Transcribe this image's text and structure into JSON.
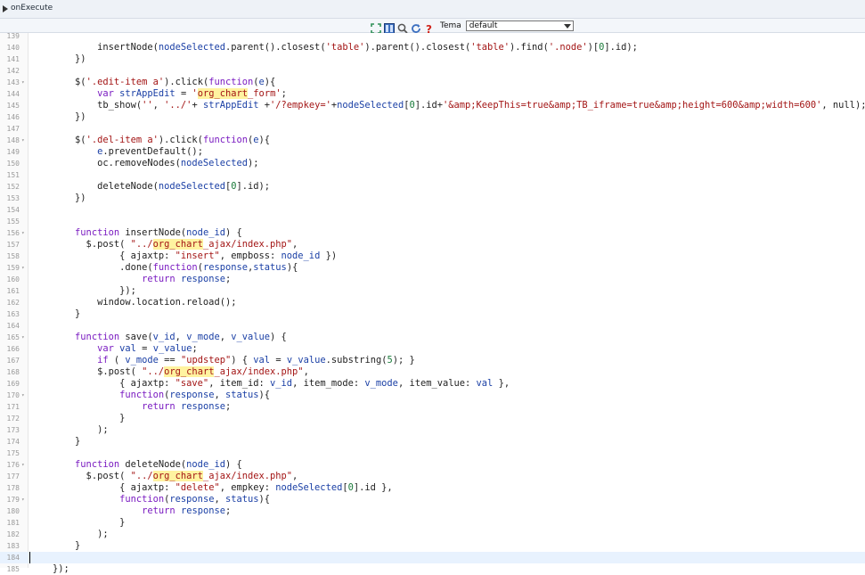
{
  "header": {
    "title": "onExecute"
  },
  "toolbar": {
    "theme_label": "Tema",
    "theme_value": "default",
    "tools": [
      "fullscreen-icon",
      "panel-icon",
      "search-icon",
      "refresh-icon",
      "help-icon"
    ]
  },
  "colors": {
    "keyword": "#7a1bc1",
    "string": "#a31515",
    "variable": "#1a3fa5",
    "number": "#1a7a3a",
    "highlight": "#fff3a0",
    "active_line": "#e8f2fe"
  },
  "editor": {
    "active_line": "184",
    "lines": [
      {
        "n": "139",
        "t": ""
      },
      {
        "n": "140",
        "t": "            insertNode(nodeSelected.parent().closest('table').parent().closest('table').find('.node')[0].id);"
      },
      {
        "n": "141",
        "t": "        })"
      },
      {
        "n": "142",
        "t": ""
      },
      {
        "n": "143",
        "fold": true,
        "t": "        $('.edit-item a').click(function(e){"
      },
      {
        "n": "144",
        "t": "            var strAppEdit = 'org_chart_form';"
      },
      {
        "n": "145",
        "t": "            tb_show('', '../'+ strAppEdit +'/?empkey='+nodeSelected[0].id+'&amp;KeepThis=true&amp;TB_iframe=true&amp;height=600&amp;width=600', null);"
      },
      {
        "n": "146",
        "t": "        })"
      },
      {
        "n": "147",
        "t": ""
      },
      {
        "n": "148",
        "fold": true,
        "t": "        $('.del-item a').click(function(e){"
      },
      {
        "n": "149",
        "t": "            e.preventDefault();"
      },
      {
        "n": "150",
        "t": "            oc.removeNodes(nodeSelected);"
      },
      {
        "n": "151",
        "t": ""
      },
      {
        "n": "152",
        "t": "            deleteNode(nodeSelected[0].id);"
      },
      {
        "n": "153",
        "t": "        })"
      },
      {
        "n": "154",
        "t": ""
      },
      {
        "n": "155",
        "t": ""
      },
      {
        "n": "156",
        "fold": true,
        "t": "        function insertNode(node_id) {"
      },
      {
        "n": "157",
        "t": "          $.post( \"../org_chart_ajax/index.php\","
      },
      {
        "n": "158",
        "t": "                { ajaxtp: \"insert\", empboss: node_id })"
      },
      {
        "n": "159",
        "fold": true,
        "t": "                .done(function(response,status){"
      },
      {
        "n": "160",
        "t": "                    return response;"
      },
      {
        "n": "161",
        "t": "                });"
      },
      {
        "n": "162",
        "t": "            window.location.reload();"
      },
      {
        "n": "163",
        "t": "        }"
      },
      {
        "n": "164",
        "t": ""
      },
      {
        "n": "165",
        "fold": true,
        "t": "        function save(v_id, v_mode, v_value) {"
      },
      {
        "n": "166",
        "t": "            var val = v_value;"
      },
      {
        "n": "167",
        "t": "            if ( v_mode == \"updstep\") { val = v_value.substring(5); }"
      },
      {
        "n": "168",
        "t": "            $.post( \"../org_chart_ajax/index.php\","
      },
      {
        "n": "169",
        "t": "                { ajaxtp: \"save\", item_id: v_id, item_mode: v_mode, item_value: val },"
      },
      {
        "n": "170",
        "fold": true,
        "t": "                function(response, status){"
      },
      {
        "n": "171",
        "t": "                    return response;"
      },
      {
        "n": "172",
        "t": "                }"
      },
      {
        "n": "173",
        "t": "            );"
      },
      {
        "n": "174",
        "t": "        }"
      },
      {
        "n": "175",
        "t": ""
      },
      {
        "n": "176",
        "fold": true,
        "t": "        function deleteNode(node_id) {"
      },
      {
        "n": "177",
        "t": "          $.post( \"../org_chart_ajax/index.php\","
      },
      {
        "n": "178",
        "t": "                { ajaxtp: \"delete\", empkey: nodeSelected[0].id },"
      },
      {
        "n": "179",
        "fold": true,
        "t": "                function(response, status){"
      },
      {
        "n": "180",
        "t": "                    return response;"
      },
      {
        "n": "181",
        "t": "                }"
      },
      {
        "n": "182",
        "t": "            );"
      },
      {
        "n": "183",
        "t": "        }"
      },
      {
        "n": "184",
        "t": ""
      },
      {
        "n": "185",
        "t": "    });"
      }
    ]
  }
}
